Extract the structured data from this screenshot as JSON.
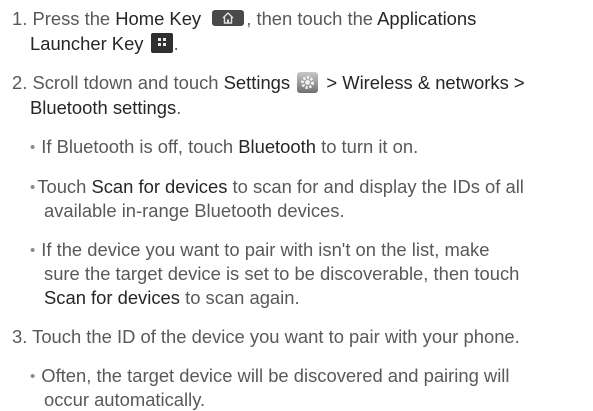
{
  "step1": {
    "number": "1.",
    "t1": "Press the ",
    "home_key": "Home Key",
    "t2": ", then touch the ",
    "applications": "Applications",
    "launcher": "Launcher Key",
    "end": "."
  },
  "step2": {
    "number": "2.",
    "t1": "Scroll tdown and touch ",
    "settings": "Settings",
    "sep1": ">",
    "wireless": "Wireless & networks",
    "sep2": ">",
    "bt_settings": "Bluetooth settings",
    "end": "."
  },
  "bullet1": {
    "t1": "If Bluetooth is off, touch ",
    "bluetooth": "Bluetooth",
    "t2": " to turn it on."
  },
  "bullet2": {
    "scan_for_devices": "Scan for devices",
    "t1": "Touch ",
    "t2": " to scan for and display the IDs of all",
    "line2": "available in-range Bluetooth devices."
  },
  "bullet3": {
    "line1": "If the device you want to pair with isn't on the list, make",
    "line2": "sure the target device is set to be discoverable, then touch",
    "scan_for_devices": "Scan for devices",
    "t2": " to scan again."
  },
  "step3": {
    "number": "3.",
    "text": "Touch the ID of the device you want to pair with your phone."
  },
  "bullet4": {
    "line1": "Often, the target device will be discovered and pairing will",
    "line2": "occur automatically."
  },
  "icons": {
    "home_key": "home-icon",
    "apps_key": "apps-grid-icon",
    "settings": "gear-icon"
  }
}
